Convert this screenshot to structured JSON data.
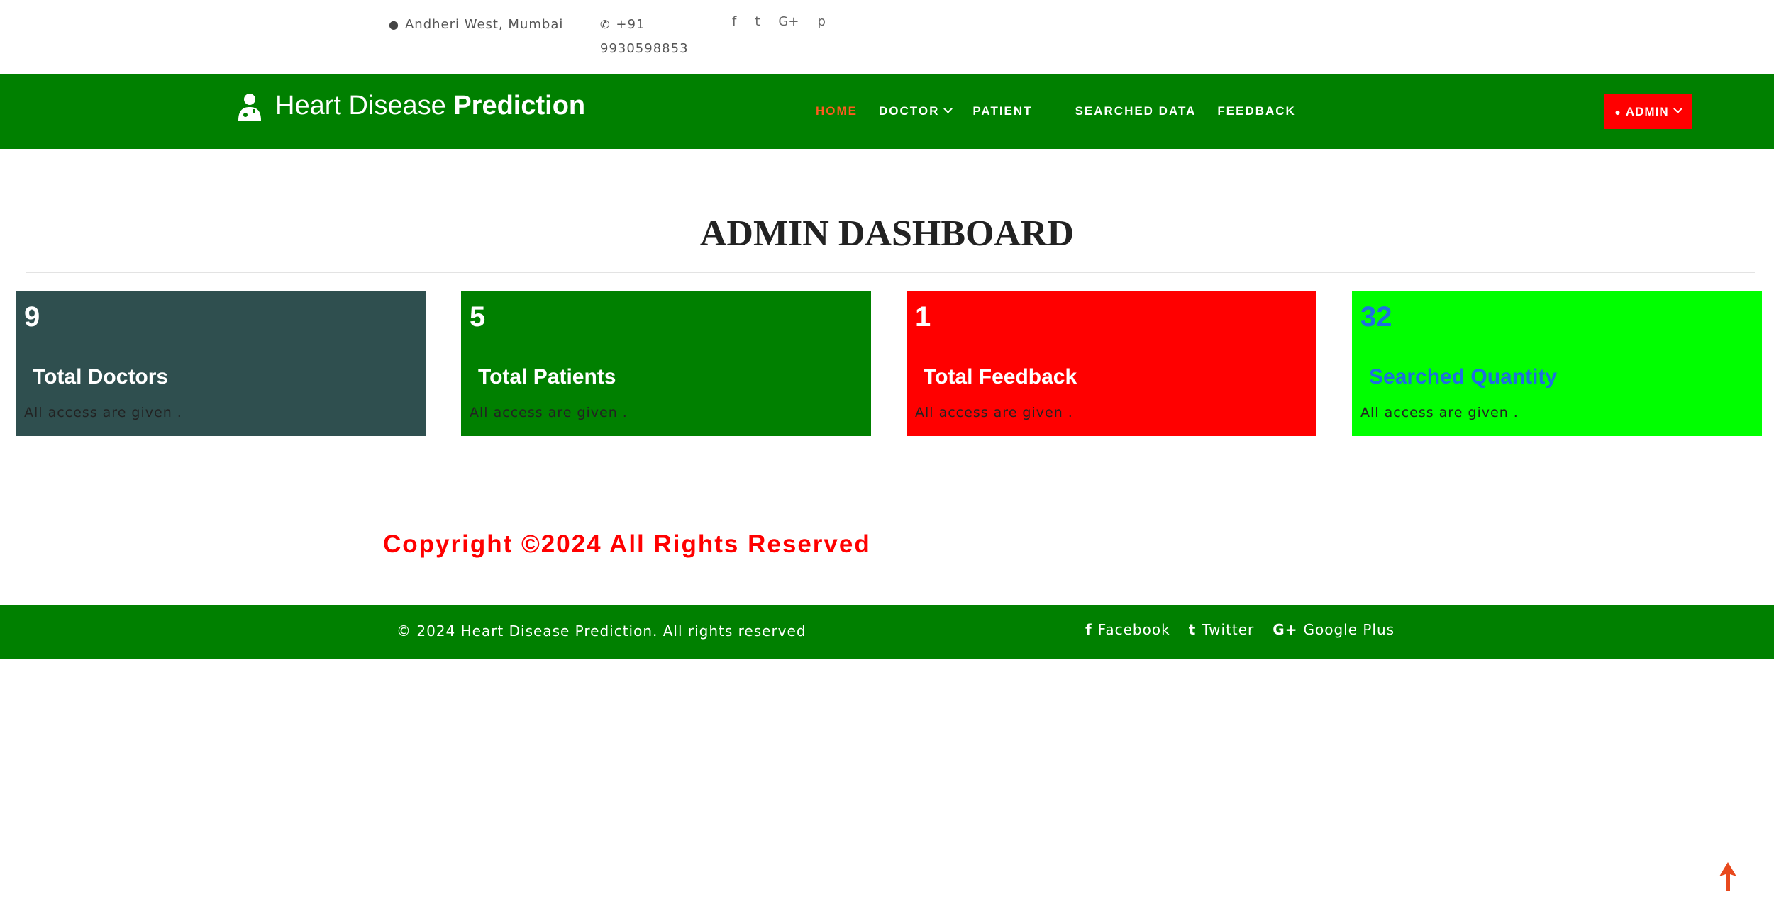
{
  "topbar": {
    "location": "Andheri West, Mumbai",
    "phone": "+91 9930598853",
    "social": [
      "f",
      "t",
      "G+",
      "p"
    ]
  },
  "navbar": {
    "brand_light": "Heart Disease ",
    "brand_bold": "Prediction",
    "links": [
      "HOME",
      "DOCTOR",
      "PATIENT",
      "SEARCHED DATA",
      "FEEDBACK"
    ],
    "admin_label": "ADMIN"
  },
  "main": {
    "title": "ADMIN DASHBOARD",
    "cards": [
      {
        "number": "9",
        "label": "Total Doctors",
        "desc": "All access are given ."
      },
      {
        "number": "5",
        "label": "Total Patients",
        "desc": "All access are given ."
      },
      {
        "number": "1",
        "label": "Total Feedback",
        "desc": "All access are given ."
      },
      {
        "number": "32",
        "label": "Searched Quantity",
        "desc": "All access are given ."
      }
    ],
    "copyright": "Copyright ©2024 All Rights Reserved"
  },
  "footer": {
    "copy": "© 2024 Heart Disease Prediction. All rights reserved",
    "links": [
      "Facebook",
      "Twitter",
      "Google Plus"
    ]
  },
  "colors": {
    "nav_green": "#008000",
    "accent_orange": "#ff5a1f",
    "admin_red": "#ff0000",
    "card_slate": "#2f4f4f",
    "card_lime": "#00ff00",
    "lime_text_blue": "#1e6fe0"
  }
}
